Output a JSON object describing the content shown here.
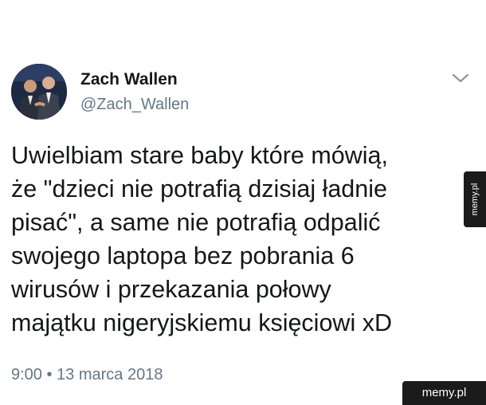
{
  "tweet": {
    "author_name": "Zach Wallen",
    "author_handle": "@Zach_Wallen",
    "text_lines": [
      "Uwielbiam stare baby które mówią,",
      "że \"dzieci nie potrafią dzisiaj ładnie",
      "pisać\", a same nie potrafią odpalić",
      "swojego laptopa bez pobrania 6",
      "wirusów i przekazania połowy",
      "majątku nigeryjskiemu księciowi xD"
    ],
    "timestamp": "9:00 • 13 marca 2018"
  },
  "icons": {
    "avatar": "avatar-photo",
    "chevron": "chevron-down-icon"
  },
  "watermark": {
    "side_text": "memy.pl",
    "corner_text": "memy.pl"
  },
  "colors": {
    "text_primary": "#14171a",
    "text_secondary": "#657786",
    "watermark_bg": "#1b1b1b"
  }
}
